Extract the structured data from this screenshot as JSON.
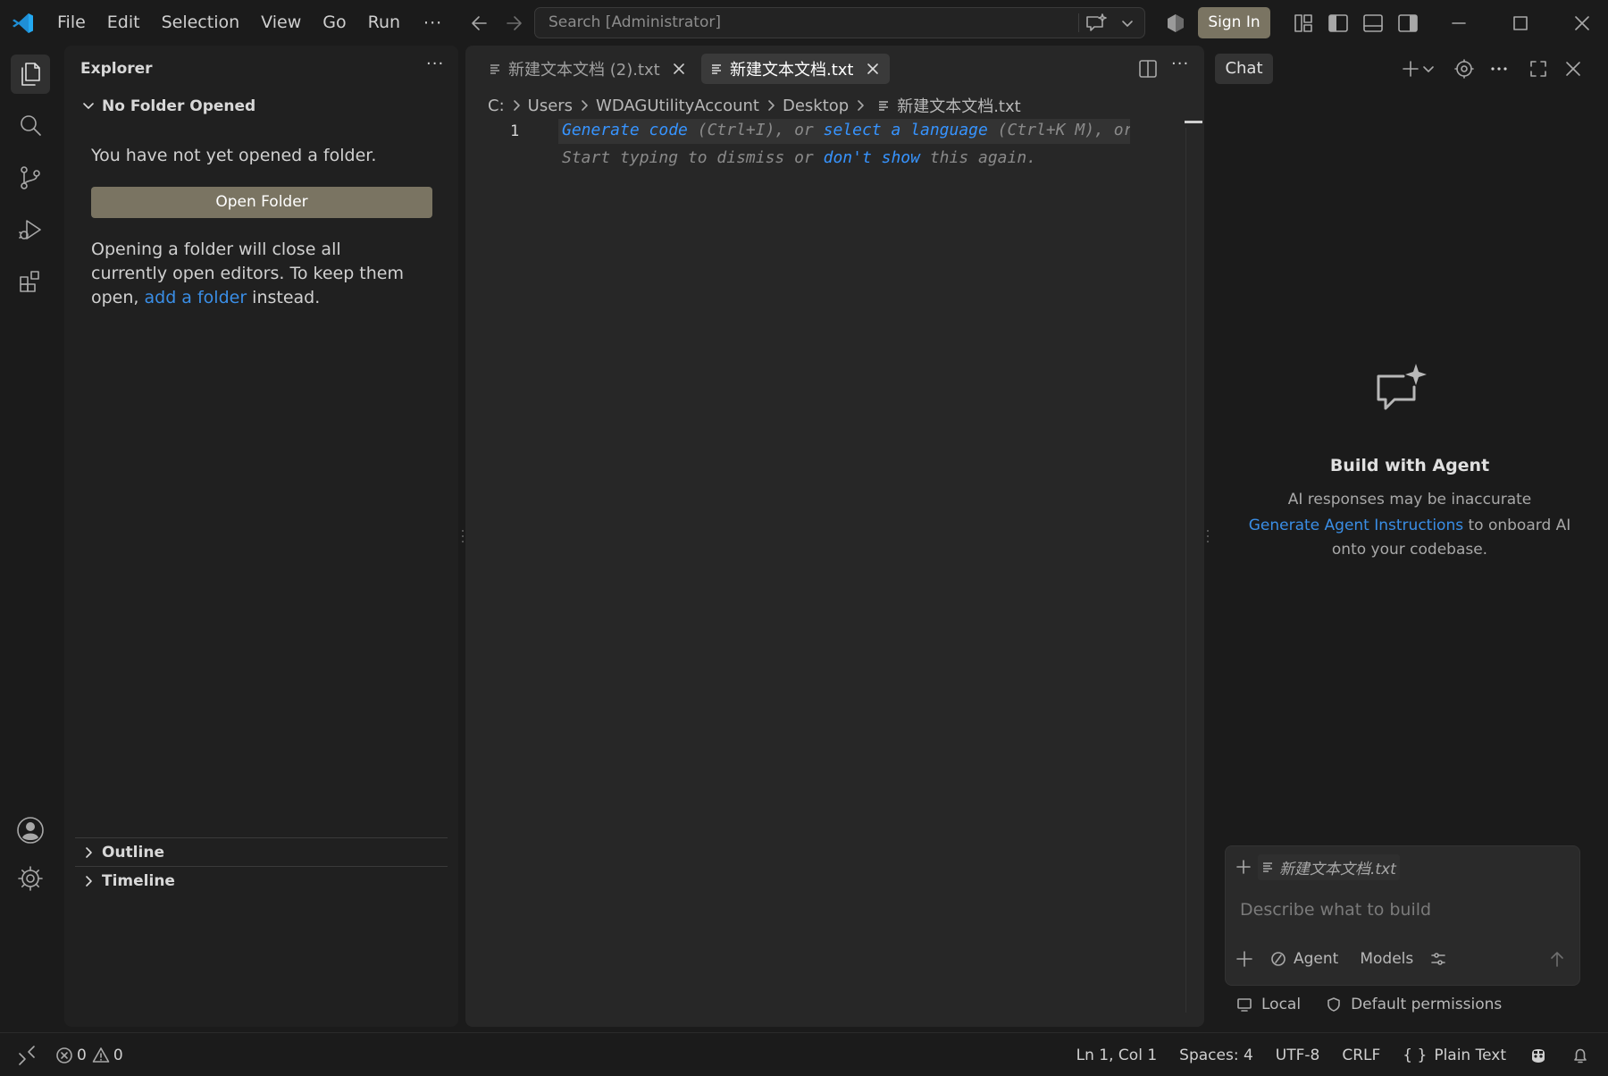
{
  "window": {
    "menu": [
      "File",
      "Edit",
      "Selection",
      "View",
      "Go",
      "Run"
    ],
    "menu_more": "···",
    "search_placeholder": "Search [Administrator]",
    "signin_label": "Sign In"
  },
  "explorer": {
    "title": "Explorer",
    "more": "···",
    "section_title": "No Folder Opened",
    "message": "You have not yet opened a folder.",
    "open_folder_label": "Open Folder",
    "para_prefix": "Opening a folder will close all currently open editors. To keep them open, ",
    "para_link": "add a folder",
    "para_suffix": " instead.",
    "outline_label": "Outline",
    "timeline_label": "Timeline"
  },
  "editor": {
    "tabs": [
      {
        "label": "新建文本文档 (2).txt",
        "active": false
      },
      {
        "label": "新建文本文档.txt",
        "active": true
      }
    ],
    "more": "···",
    "breadcrumb": [
      "C:",
      "Users",
      "WDAGUtilityAccount",
      "Desktop",
      "新建文本文档.txt"
    ],
    "line_number": "1",
    "hint_line1": {
      "p1": "Generate code",
      "p2": " (Ctrl+I), or ",
      "p3": "select a language",
      "p4": " (Ctrl+K M), or fill with template..."
    },
    "hint_line2": {
      "p1": "Start typing to dismiss or ",
      "p2": "don't show",
      "p3": " this again."
    }
  },
  "chat": {
    "tab_label": "Chat",
    "title": "Build with Agent",
    "subtitle": "AI responses may be inaccurate",
    "info_link": "Generate Agent Instructions",
    "info_rest": " to onboard AI onto your codebase.",
    "context_file": "新建文本文档.txt",
    "input_placeholder": "Describe what to build",
    "mode_label": "Agent",
    "models_label": "Models",
    "footer_local": "Local",
    "footer_permissions": "Default permissions"
  },
  "status": {
    "errors": "0",
    "warnings": "0",
    "position": "Ln 1, Col 1",
    "spaces": "Spaces: 4",
    "encoding": "UTF-8",
    "eol": "CRLF",
    "language": "Plain Text"
  },
  "colors": {
    "accent_button": "#7a7462",
    "link": "#3a8ee6",
    "hint_keyword": "#3794ff",
    "vscode_logo": "#23a9f2"
  }
}
